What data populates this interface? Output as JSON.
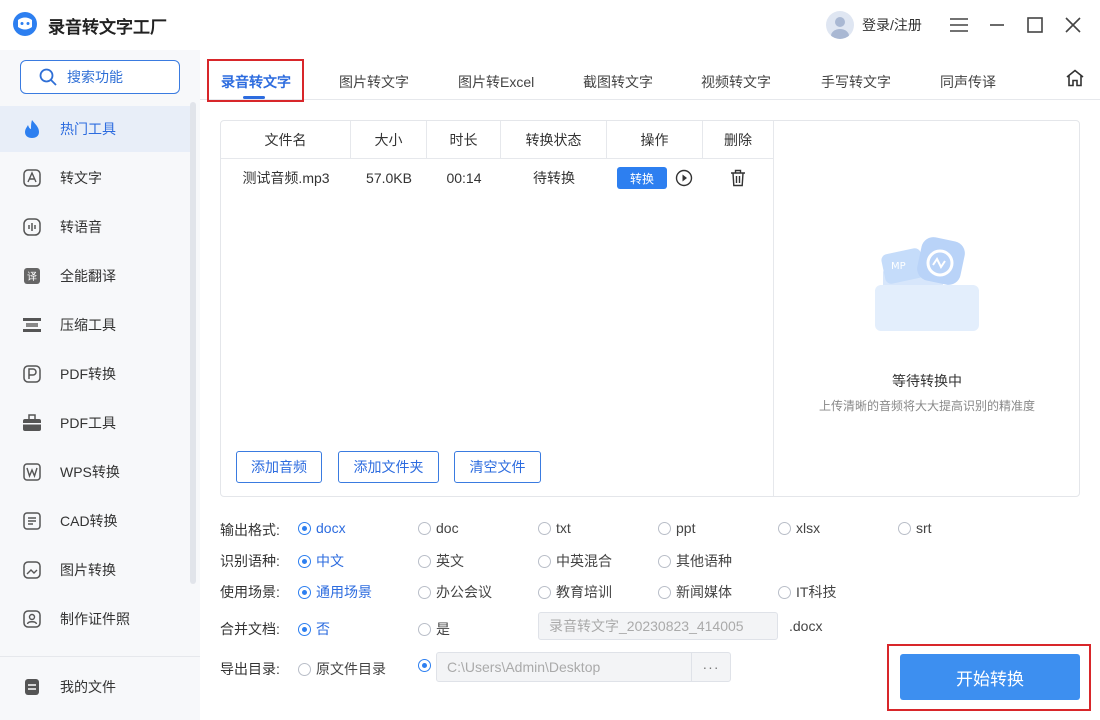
{
  "app": {
    "title": "录音转文字工厂",
    "login": "登录/注册"
  },
  "sidebar": {
    "search_label": "搜索功能",
    "items": [
      {
        "label": "热门工具",
        "icon": "fire-icon"
      },
      {
        "label": "转文字",
        "icon": "text-convert-icon"
      },
      {
        "label": "转语音",
        "icon": "voice-icon"
      },
      {
        "label": "全能翻译",
        "icon": "translate-icon"
      },
      {
        "label": "压缩工具",
        "icon": "compress-icon"
      },
      {
        "label": "PDF转换",
        "icon": "pdf-convert-icon"
      },
      {
        "label": "PDF工具",
        "icon": "toolbox-icon"
      },
      {
        "label": "WPS转换",
        "icon": "wps-icon"
      },
      {
        "label": "CAD转换",
        "icon": "cad-icon"
      },
      {
        "label": "图片转换",
        "icon": "image-icon"
      },
      {
        "label": "制作证件照",
        "icon": "id-photo-icon"
      }
    ],
    "my_files": "我的文件"
  },
  "tabs": [
    "录音转文字",
    "图片转文字",
    "图片转Excel",
    "截图转文字",
    "视频转文字",
    "手写转文字",
    "同声传译"
  ],
  "table": {
    "headers": [
      "文件名",
      "大小",
      "时长",
      "转换状态",
      "操作",
      "删除"
    ],
    "rows": [
      {
        "name": "测试音频.mp3",
        "size": "57.0KB",
        "duration": "00:14",
        "status": "待转换",
        "action": "转换"
      }
    ]
  },
  "buttons": {
    "add_audio": "添加音频",
    "add_folder": "添加文件夹",
    "clear_files": "清空文件",
    "start": "开始转换"
  },
  "preview": {
    "title": "等待转换中",
    "subtitle": "上传清晰的音频将大大提高识别的精准度",
    "badge": "MP"
  },
  "options": {
    "format_label": "输出格式:",
    "formats": [
      "docx",
      "doc",
      "txt",
      "ppt",
      "xlsx",
      "srt"
    ],
    "language_label": "识别语种:",
    "languages": [
      "中文",
      "英文",
      "中英混合",
      "其他语种"
    ],
    "scene_label": "使用场景:",
    "scenes": [
      "通用场景",
      "办公会议",
      "教育培训",
      "新闻媒体",
      "IT科技"
    ],
    "merge_label": "合并文档:",
    "merge": [
      "否",
      "是"
    ],
    "merge_filename": "录音转文字_20230823_414005",
    "merge_ext": ".docx",
    "export_label": "导出目录:",
    "export_original": "原文件目录",
    "export_path": "C:\\Users\\Admin\\Desktop",
    "browse": "···"
  },
  "colors": {
    "accent": "#2d7ff0",
    "highlight": "#d8262a",
    "start_button": "#3d8ff0"
  }
}
